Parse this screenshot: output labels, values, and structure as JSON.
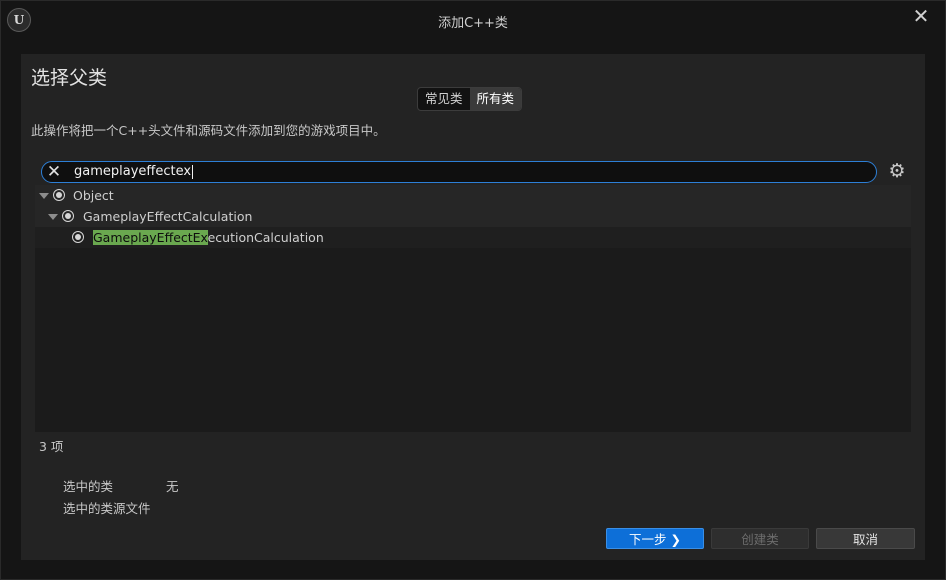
{
  "window": {
    "title": "添加C++类",
    "logo_text": "U"
  },
  "header": {
    "heading": "选择父类",
    "tabs": [
      "常见类",
      "所有类"
    ],
    "active_tab": "所有类",
    "description": "此操作将把一个C++头文件和源码文件添加到您的游戏项目中。"
  },
  "search": {
    "value": "gameplayeffectex"
  },
  "tree": {
    "items": [
      {
        "label": "Object",
        "depth": 0,
        "expanded": true
      },
      {
        "label": "GameplayEffectCalculation",
        "depth": 1,
        "expanded": true
      },
      {
        "label_match": "GameplayEffectEx",
        "label_rest": "ecutionCalculation",
        "depth": 2,
        "leaf": true
      }
    ]
  },
  "status": {
    "count_text": "3 项"
  },
  "selection": {
    "selected_class_label": "选中的类",
    "selected_class_value": "无",
    "source_file_label": "选中的类源文件"
  },
  "buttons": {
    "next": "下一步",
    "create": "创建类",
    "cancel": "取消"
  },
  "colors": {
    "accent": "#0d6fd8",
    "search_focus": "#2d7fd6",
    "highlight": "#6aa84f"
  }
}
